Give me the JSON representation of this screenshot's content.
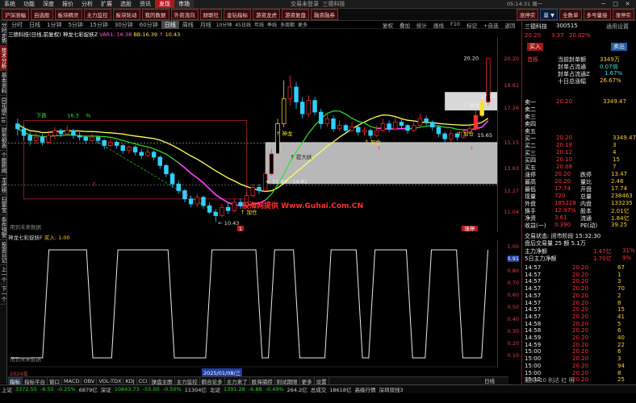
{
  "menu": {
    "items": [
      "系统",
      "功能",
      "深度",
      "报价",
      "分析",
      "扩展",
      "选股",
      "资讯",
      "发现",
      "市场",
      "交易未登录",
      "三德科技"
    ],
    "clock": "05:14:31 周一",
    "win": [
      "─",
      "□",
      "✕"
    ]
  },
  "toolbar": {
    "left": [
      "沪深涨幅",
      "自选股",
      "板块精灵",
      "主力监控",
      "板块轮动",
      "我的数据",
      "外资流向",
      "财联社",
      "金钻指标",
      "游资龙虎",
      "游资复盘",
      "融资融券"
    ],
    "right": [
      "涨停实",
      "量 ▼",
      "全数单",
      "多号量接",
      "涨停实"
    ]
  },
  "leftstrip": [
    "分时走势",
    "技术分析",
    "基本资料",
    "同花顺F10",
    "财务报表",
    "个股新闻",
    "龙虎榜",
    "扫雷宝",
    "条件预警",
    "投资日记",
    "上一个",
    "下一个"
  ],
  "periods": [
    "分时",
    "日线",
    "1分钟",
    "5分钟",
    "15分钟",
    "30分钟",
    "60分钟",
    "日线",
    "周线",
    "月线",
    "10分钟",
    "45日线",
    "年线",
    "季线",
    "多周期",
    "更多"
  ],
  "period_right": [
    "复权",
    "叠加",
    "统计",
    "画线",
    "F10",
    "标记",
    "+自选",
    "返回"
  ],
  "infoline": {
    "name": "三德科技(日线,前复权)",
    "ind": "神龙七彩捉妖Z",
    "v1": "VAR1: 16.38",
    "v2": "BB:16.39",
    "v3": "↑",
    "v4": "10.43"
  },
  "price_levels": [
    {
      "p": "20.20"
    },
    {
      "p": "18.61"
    },
    {
      "p": "17.26"
    },
    {
      "p": "15.15"
    },
    {
      "p": "13.63"
    },
    {
      "p": "12.27"
    },
    {
      "p": "11.04"
    }
  ],
  "chart_labels": {
    "top_price": "20.20",
    "price_1774": "17.74",
    "low_price": "10.43",
    "box_low": "12.64 - 14.81",
    "buy1": "加仓",
    "buy2": "加仓",
    "buy3": "加仓",
    "shenlong1": "神龙",
    "shenlong2": "神龙",
    "tidazhang": "提大妖",
    "xiaxian": "下跌",
    "p163": "16.3",
    "pct": "%",
    "p1565": "15.65",
    "lblue": "加仓",
    "note_left": "用到未来数据",
    "note_sub": "用到未来数据",
    "tag_year": "1",
    "tag_right": "涨停"
  },
  "candles": [
    {
      "o": 16.3,
      "c": 16.0,
      "h": 16.6,
      "l": 15.6
    },
    {
      "o": 16.0,
      "c": 15.6,
      "h": 16.2,
      "l": 15.3
    },
    {
      "o": 15.6,
      "c": 15.3,
      "h": 15.8,
      "l": 15.0
    },
    {
      "o": 15.3,
      "c": 15.5,
      "h": 15.8,
      "l": 15.1
    },
    {
      "o": 15.5,
      "c": 15.2,
      "h": 15.7,
      "l": 15.0
    },
    {
      "o": 15.2,
      "c": 15.6,
      "h": 15.9,
      "l": 15.1
    },
    {
      "o": 15.6,
      "c": 15.9,
      "h": 16.1,
      "l": 15.4
    },
    {
      "o": 15.9,
      "c": 15.7,
      "h": 16.0,
      "l": 15.5
    },
    {
      "o": 15.7,
      "c": 15.9,
      "h": 16.2,
      "l": 15.6
    },
    {
      "o": 15.9,
      "c": 15.6,
      "h": 16.0,
      "l": 15.4
    },
    {
      "o": 15.6,
      "c": 15.5,
      "h": 15.8,
      "l": 15.3
    },
    {
      "o": 15.5,
      "c": 15.3,
      "h": 15.6,
      "l": 15.1
    },
    {
      "o": 15.3,
      "c": 15.5,
      "h": 15.7,
      "l": 15.2
    },
    {
      "o": 15.5,
      "c": 15.3,
      "h": 15.6,
      "l": 15.1
    },
    {
      "o": 15.3,
      "c": 15.0,
      "h": 15.4,
      "l": 14.8
    },
    {
      "o": 15.0,
      "c": 15.2,
      "h": 15.4,
      "l": 14.9
    },
    {
      "o": 15.2,
      "c": 15.0,
      "h": 15.3,
      "l": 14.8
    },
    {
      "o": 15.0,
      "c": 14.7,
      "h": 15.1,
      "l": 14.5
    },
    {
      "o": 14.7,
      "c": 14.9,
      "h": 15.0,
      "l": 14.5
    },
    {
      "o": 14.9,
      "c": 14.6,
      "h": 15.0,
      "l": 14.4
    },
    {
      "o": 14.6,
      "c": 14.4,
      "h": 14.8,
      "l": 14.2
    },
    {
      "o": 14.4,
      "c": 14.6,
      "h": 14.9,
      "l": 14.3
    },
    {
      "o": 14.6,
      "c": 14.3,
      "h": 14.7,
      "l": 14.1
    },
    {
      "o": 14.3,
      "c": 13.8,
      "h": 14.4,
      "l": 13.6
    },
    {
      "o": 13.8,
      "c": 13.3,
      "h": 13.9,
      "l": 13.1
    },
    {
      "o": 13.3,
      "c": 12.7,
      "h": 13.4,
      "l": 12.5
    },
    {
      "o": 12.7,
      "c": 12.3,
      "h": 12.9,
      "l": 12.1
    },
    {
      "o": 12.3,
      "c": 11.8,
      "h": 12.4,
      "l": 11.6
    },
    {
      "o": 11.8,
      "c": 11.5,
      "h": 12.0,
      "l": 11.3
    },
    {
      "o": 11.5,
      "c": 11.9,
      "h": 12.1,
      "l": 11.3
    },
    {
      "o": 11.9,
      "c": 11.4,
      "h": 12.0,
      "l": 11.2
    },
    {
      "o": 11.4,
      "c": 11.0,
      "h": 11.6,
      "l": 10.9
    },
    {
      "o": 11.0,
      "c": 10.8,
      "h": 11.2,
      "l": 10.43
    },
    {
      "o": 10.8,
      "c": 11.3,
      "h": 11.5,
      "l": 10.7
    },
    {
      "o": 11.3,
      "c": 11.1,
      "h": 11.6,
      "l": 10.9
    },
    {
      "o": 11.1,
      "c": 11.6,
      "h": 11.8,
      "l": 11.0
    },
    {
      "o": 11.6,
      "c": 11.4,
      "h": 11.8,
      "l": 11.2
    },
    {
      "o": 11.4,
      "c": 12.0,
      "h": 12.2,
      "l": 11.3
    },
    {
      "o": 12.0,
      "c": 12.5,
      "h": 12.7,
      "l": 11.9
    },
    {
      "o": 12.5,
      "c": 12.3,
      "h": 12.7,
      "l": 12.1
    },
    {
      "o": 12.3,
      "c": 13.3,
      "h": 13.5,
      "l": 12.2
    },
    {
      "o": 13.3,
      "c": 14.5,
      "h": 14.8,
      "l": 13.2
    },
    {
      "o": 14.5,
      "c": 16.3,
      "h": 16.6,
      "l": 14.4
    },
    {
      "o": 16.3,
      "c": 17.8,
      "h": 18.9,
      "l": 16.1
    },
    {
      "o": 17.8,
      "c": 18.5,
      "h": 19.2,
      "l": 17.4
    },
    {
      "o": 18.5,
      "c": 17.6,
      "h": 18.8,
      "l": 17.2
    },
    {
      "o": 17.6,
      "c": 16.9,
      "h": 17.9,
      "l": 16.6
    },
    {
      "o": 16.9,
      "c": 17.7,
      "h": 18.0,
      "l": 16.7
    },
    {
      "o": 17.7,
      "c": 17.0,
      "h": 17.9,
      "l": 16.8
    },
    {
      "o": 17.0,
      "c": 16.3,
      "h": 17.2,
      "l": 16.0
    },
    {
      "o": 16.3,
      "c": 16.6,
      "h": 16.9,
      "l": 16.1
    },
    {
      "o": 16.6,
      "c": 16.0,
      "h": 16.8,
      "l": 15.8
    },
    {
      "o": 16.0,
      "c": 16.2,
      "h": 16.5,
      "l": 15.9
    },
    {
      "o": 16.2,
      "c": 15.9,
      "h": 16.3,
      "l": 15.7
    },
    {
      "o": 15.9,
      "c": 16.1,
      "h": 16.4,
      "l": 15.8
    },
    {
      "o": 16.1,
      "c": 15.8,
      "h": 16.2,
      "l": 15.6
    },
    {
      "o": 15.8,
      "c": 15.9,
      "h": 16.1,
      "l": 15.6
    },
    {
      "o": 15.9,
      "c": 15.6,
      "h": 16.0,
      "l": 15.4
    },
    {
      "o": 15.6,
      "c": 15.9,
      "h": 16.2,
      "l": 15.5
    },
    {
      "o": 15.9,
      "c": 16.3,
      "h": 16.6,
      "l": 15.8
    },
    {
      "o": 16.3,
      "c": 16.0,
      "h": 16.5,
      "l": 15.8
    },
    {
      "o": 16.0,
      "c": 16.4,
      "h": 16.7,
      "l": 15.9
    },
    {
      "o": 16.4,
      "c": 16.2,
      "h": 16.6,
      "l": 16.0
    },
    {
      "o": 16.2,
      "c": 15.9,
      "h": 16.3,
      "l": 15.7
    },
    {
      "o": 15.9,
      "c": 16.2,
      "h": 16.4,
      "l": 15.8
    },
    {
      "o": 16.2,
      "c": 16.6,
      "h": 16.9,
      "l": 16.1
    },
    {
      "o": 16.6,
      "c": 16.4,
      "h": 16.8,
      "l": 16.2
    },
    {
      "o": 16.4,
      "c": 16.1,
      "h": 16.5,
      "l": 15.9
    },
    {
      "o": 16.1,
      "c": 15.7,
      "h": 16.2,
      "l": 15.5
    },
    {
      "o": 15.7,
      "c": 15.4,
      "h": 15.8,
      "l": 15.2
    },
    {
      "o": 15.4,
      "c": 15.7,
      "h": 15.9,
      "l": 15.2
    },
    {
      "o": 15.7,
      "c": 15.5,
      "h": 15.8,
      "l": 15.3
    },
    {
      "o": 15.5,
      "c": 15.8,
      "h": 16.0,
      "l": 15.4
    },
    {
      "o": 15.8,
      "c": 16.0,
      "h": 16.2,
      "l": 15.7
    },
    {
      "o": 16.0,
      "c": 16.8,
      "h": 17.1,
      "l": 15.9
    },
    {
      "o": 16.8,
      "c": 17.6,
      "h": 17.9,
      "l": 16.7
    },
    {
      "o": 17.6,
      "c": 20.2,
      "h": 20.2,
      "l": 17.4
    }
  ],
  "sub_signal": [
    0,
    0,
    0,
    0,
    0,
    0,
    1,
    1,
    1,
    1,
    1,
    1,
    1,
    0,
    0,
    0,
    0,
    1,
    1,
    1,
    1,
    1,
    1,
    1,
    1,
    1,
    0,
    0,
    0,
    0,
    0,
    0,
    1,
    1,
    1,
    1,
    1,
    1,
    1,
    1,
    0,
    0,
    1,
    1,
    1,
    1,
    0,
    0,
    0,
    0,
    0,
    1,
    1,
    1,
    1,
    1,
    0,
    0,
    1,
    1,
    1,
    1,
    1,
    1,
    0,
    0,
    0,
    1,
    1,
    1,
    1,
    1,
    0,
    0,
    0,
    0,
    1
  ],
  "sub_hdr": {
    "name": "神龙七彩捉妖F",
    "val": "买入: 1.00"
  },
  "sub_levels": [
    "1.00",
    "0.91",
    "0.80",
    "0.70",
    "0.60",
    "0.50",
    "0.40",
    "0.30",
    "0.20",
    "0.10"
  ],
  "date_axis": {
    "year": "2024年",
    "sel": "2025/01/08/三"
  },
  "bottomtabs": [
    "指标",
    "指标平台",
    "窗口",
    "MACD",
    "OBV",
    "VOL-TDX",
    "KDJ",
    "CCI",
    "操盘主图",
    "主力监控",
    "鹤合论多",
    "主力来了",
    "股海捕捞",
    "则试期限",
    "更多",
    "设置"
  ],
  "bt_right": "日线",
  "status": [
    {
      "t": "扩展",
      "c": "dim"
    },
    {
      "t": "关联报价",
      "c": "dim"
    },
    {
      "t": "资金流向",
      "c": "dim"
    },
    {
      "t": "盘面分析",
      "c": "dim"
    },
    {
      "t": "插外资金",
      "c": "dim"
    },
    {
      "t": "资金监控",
      "c": "dim"
    },
    {
      "t": "短线精灵",
      "c": "dim"
    },
    {
      "t": "涨跌股数",
      "c": "dim"
    },
    {
      "t": "逐笔委托",
      "c": "dim"
    },
    {
      "t": "综合资讯",
      "c": "dim"
    },
    {
      "t": "行业资讯",
      "c": "dim"
    },
    {
      "t": "行业资讯",
      "c": "dim"
    },
    {
      "t": "互动期杆",
      "c": "dim"
    },
    {
      "t": "扫雷宝",
      "c": "dim"
    }
  ],
  "status2": [
    {
      "t": "上证",
      "c": "sl"
    },
    {
      "t": "3372.55",
      "c": "dn"
    },
    {
      "t": "-8.55",
      "c": "dn"
    },
    {
      "t": "-0.25%",
      "c": "dn"
    },
    {
      "t": "6879亿",
      "c": "sl"
    },
    {
      "t": "深证",
      "c": "sl"
    },
    {
      "t": "10843.73",
      "c": "dn"
    },
    {
      "t": "-55.00",
      "c": "dn"
    },
    {
      "t": "-0.50%",
      "c": "dn"
    },
    {
      "t": "11304亿",
      "c": "sl"
    },
    {
      "t": "北证",
      "c": "sl"
    },
    {
      "t": "1391.28",
      "c": "dn"
    },
    {
      "t": "-6.88",
      "c": "dn"
    },
    {
      "t": "-0.49%",
      "c": "dn"
    },
    {
      "t": "264.2亿",
      "c": "sl"
    },
    {
      "t": "总成交",
      "c": "sl"
    },
    {
      "t": "18618亿",
      "c": "sl"
    },
    {
      "t": "高级行情",
      "c": "sl"
    },
    {
      "t": "深圳双线3",
      "c": "sl"
    }
  ],
  "brand": "股海网 股票软件资源",
  "watermark": "股海网提供 Www.Guhai.Com.CN",
  "rp": {
    "stock_name": "三德科技",
    "code": "300515",
    "account": "通用设置",
    "price": "20.20",
    "chg": "3.37",
    "pct": "20.02%",
    "buy_btn": "买入",
    "sell_btn": "卖出",
    "shou": "首板",
    "f1": {
      "l": "当前封单额",
      "v": "3349万"
    },
    "f2": {
      "l": "封单占流通",
      "v": "0.07倍"
    },
    "f3": {
      "l": "封单占流通Z",
      "v": "1.67%"
    },
    "f4": {
      "l": "十日总涨幅",
      "v": "26.67%"
    },
    "sells": [
      {
        "l": "卖一",
        "p": "20.20",
        "v": "3349.47"
      },
      {
        "l": "卖二",
        "p": "",
        "v": ""
      },
      {
        "l": "卖三",
        "p": "",
        "v": ""
      },
      {
        "l": "卖四",
        "p": "",
        "v": ""
      },
      {
        "l": "卖五",
        "p": "",
        "v": ""
      }
    ],
    "buys": [
      {
        "l": "买一",
        "p": "20.20",
        "v": "3349.47"
      },
      {
        "l": "买二",
        "p": "20.18",
        "v": "3"
      },
      {
        "l": "买三",
        "p": "20.12",
        "v": "4"
      },
      {
        "l": "买四",
        "p": "20.10",
        "v": "15"
      },
      {
        "l": "买五",
        "p": "20.08",
        "v": "7"
      }
    ],
    "stats": [
      {
        "a": "涨停",
        "av": "20.20",
        "b": "跌停",
        "bv": "13.47"
      },
      {
        "a": "最高",
        "av": "20.20",
        "b": "量比",
        "bv": "2.46"
      },
      {
        "a": "最低",
        "av": "17.74",
        "b": "开盘",
        "bv": "17.74"
      },
      {
        "a": "现量",
        "av": "720",
        "b": "总量",
        "bv": "238463"
      },
      {
        "a": "外盘",
        "av": "185228",
        "b": "内盘",
        "bv": "133235"
      },
      {
        "a": "换手",
        "av": "12.97%",
        "b": "股本",
        "bv": "2.01亿"
      },
      {
        "a": "净资",
        "av": "3.61",
        "b": "流通",
        "bv": "1.84亿"
      },
      {
        "a": "收益(一)",
        "av": "0.390",
        "b": "PE(动)",
        "bv": "39.25"
      }
    ],
    "trade_status": "交易状态: 闭市阶段 15:32:30",
    "after": "盘后交易量 25 额 5.1万",
    "main1": {
      "l": "主力净额",
      "v": "1.47亿",
      "p": "31%"
    },
    "main5": {
      "l": "5日主力净额",
      "v": "1.70亿",
      "p": "9%"
    },
    "ticks": [
      {
        "t": "14:57",
        "p": "20.20",
        "v": "67"
      },
      {
        "t": "14:57",
        "p": "20.20",
        "v": "1"
      },
      {
        "t": "14:57",
        "p": "20.20",
        "v": "3"
      },
      {
        "t": "14:57",
        "p": "20.20",
        "v": "70"
      },
      {
        "t": "14:57",
        "p": "20.20",
        "v": "2"
      },
      {
        "t": "14:57",
        "p": "20.20",
        "v": "8"
      },
      {
        "t": "14:57",
        "p": "20.20",
        "v": "15"
      },
      {
        "t": "14:57",
        "p": "20.20",
        "v": "41"
      },
      {
        "t": "14:58",
        "p": "20.20",
        "v": "5"
      },
      {
        "t": "14:58",
        "p": "20.20",
        "v": "6"
      },
      {
        "t": "14:59",
        "p": "20.20",
        "v": "40"
      },
      {
        "t": "14:59",
        "p": "20.20",
        "v": "22"
      },
      {
        "t": "15:00",
        "p": "20.20",
        "v": "6"
      },
      {
        "t": "15:00",
        "p": "20.20",
        "v": "3"
      },
      {
        "t": "15:00",
        "p": "20.20",
        "v": "94"
      },
      {
        "t": "15:00",
        "p": "20.20",
        "v": "8"
      },
      {
        "t": "15:12",
        "p": "20.20",
        "v": "25"
      }
    ],
    "bottom_tabs": "图文F10 利达 红 明"
  }
}
